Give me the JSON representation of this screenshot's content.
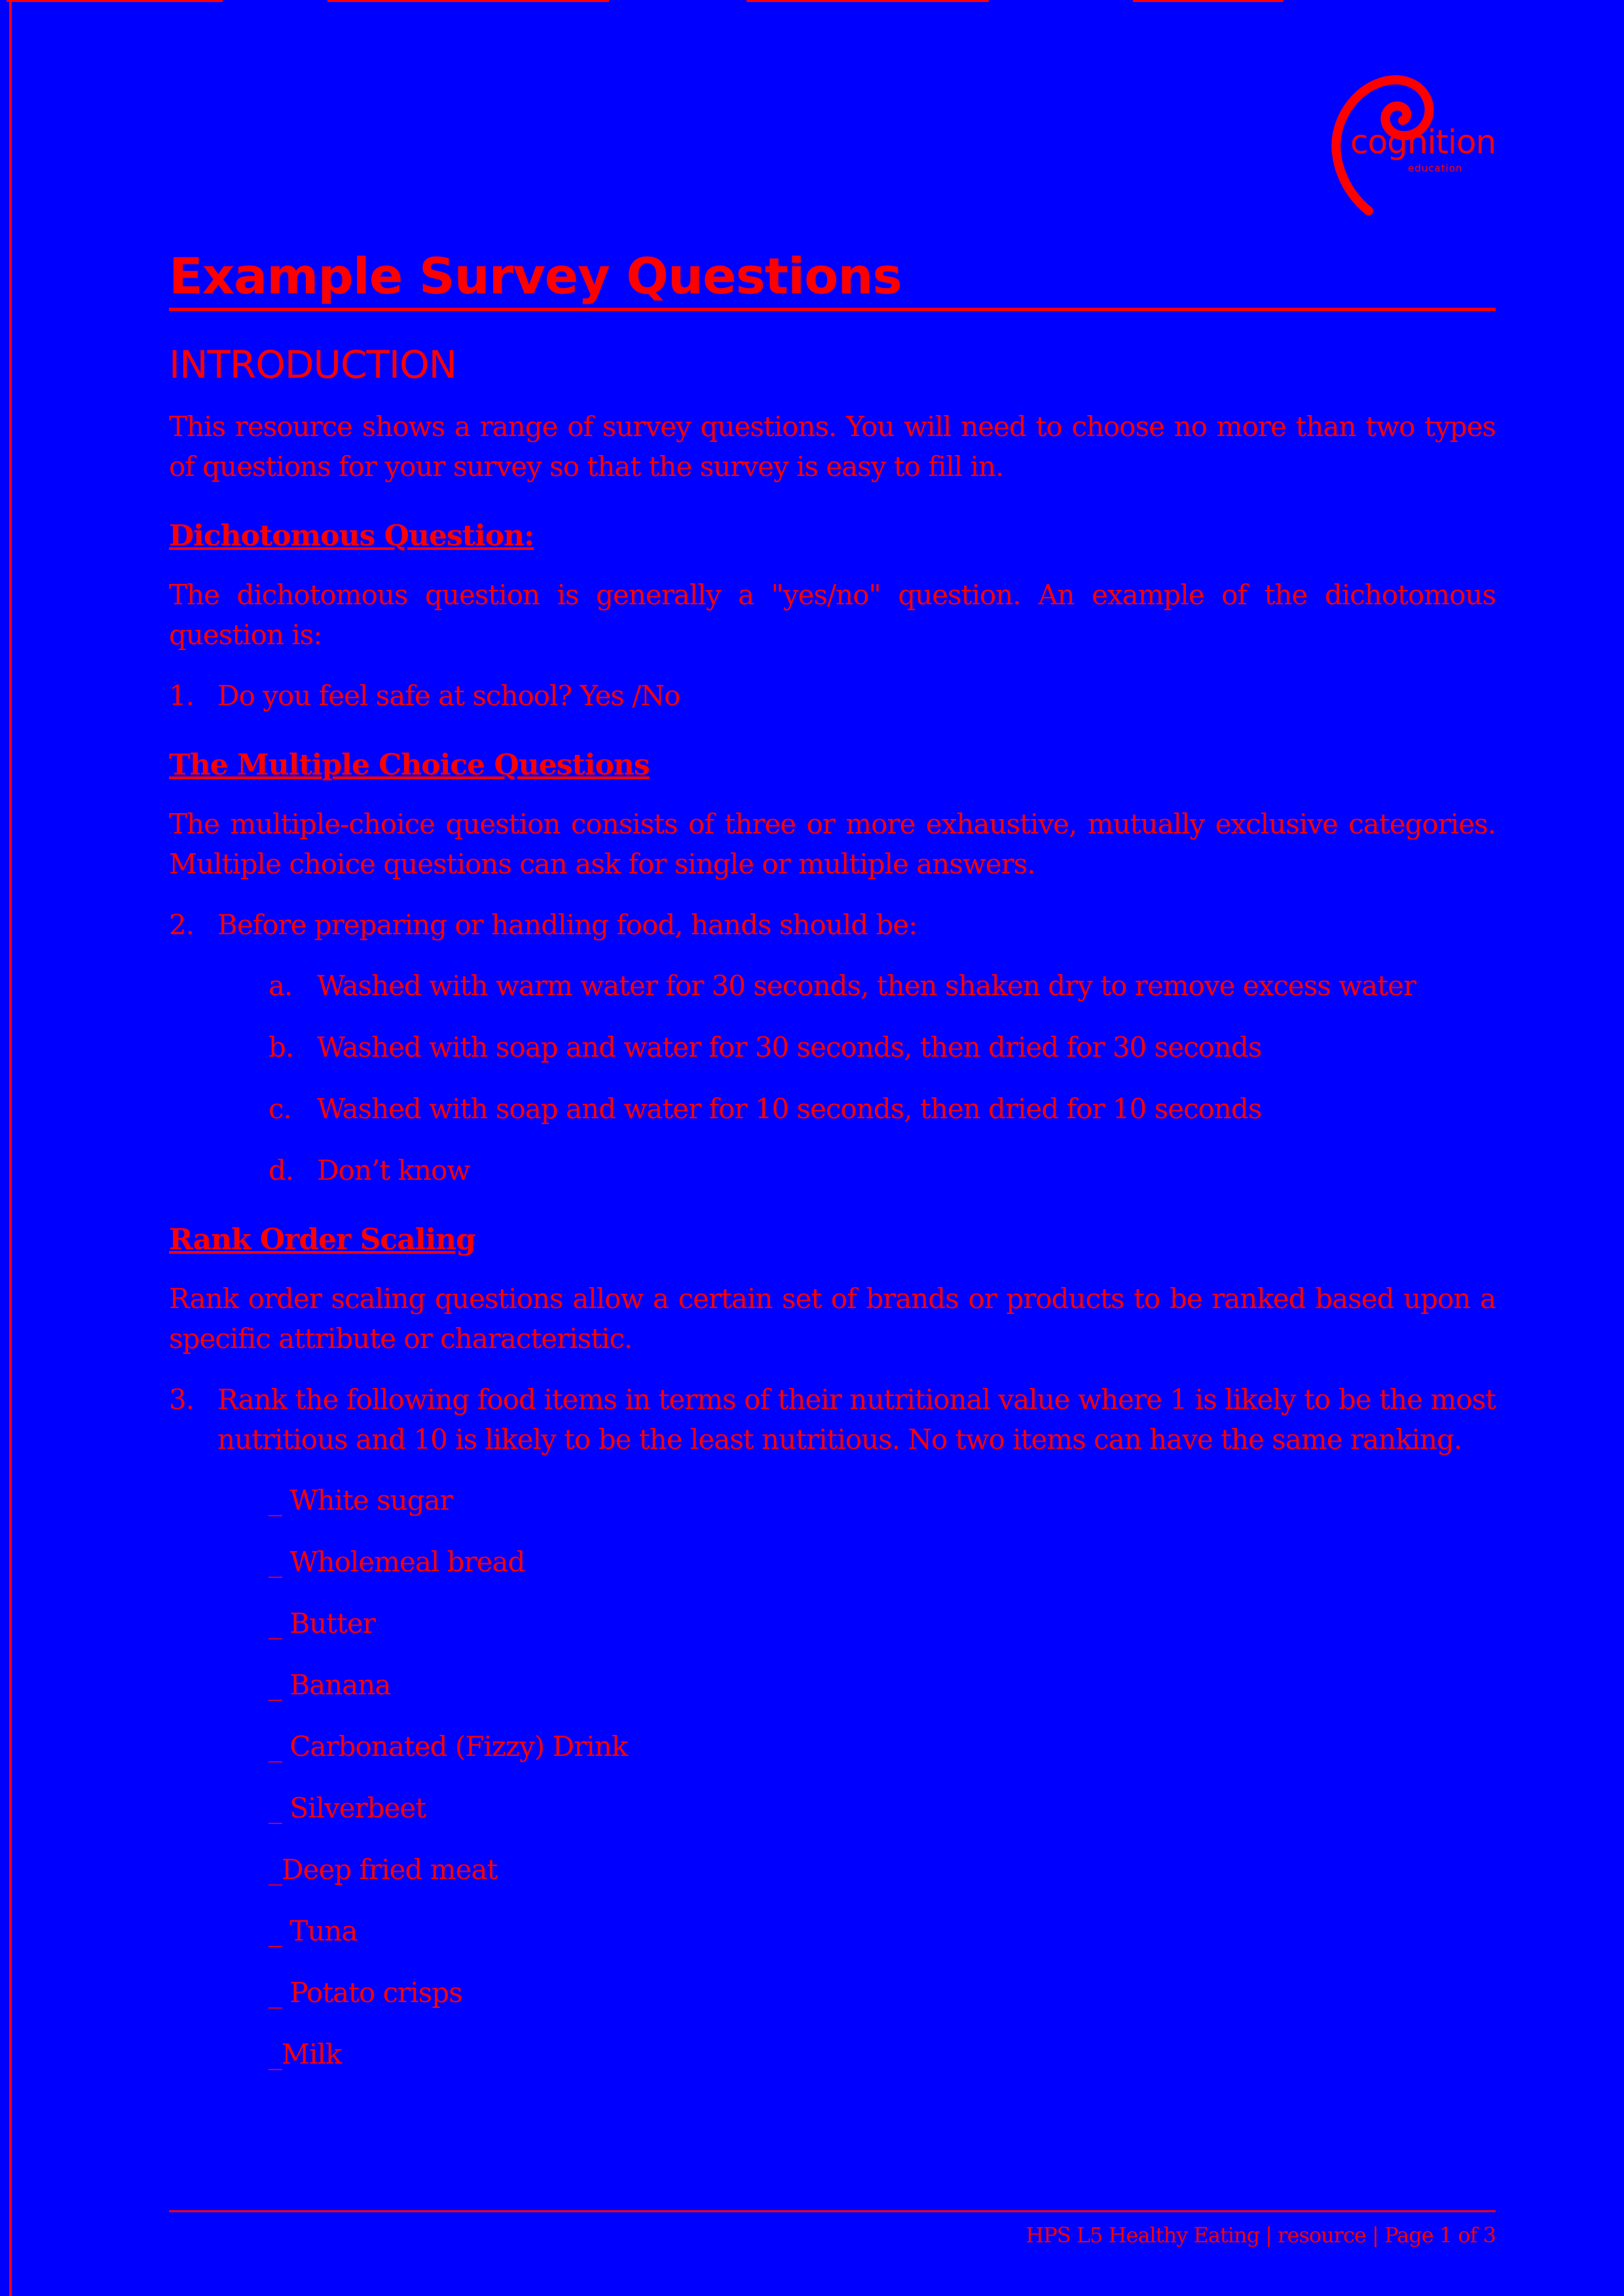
{
  "logo": {
    "word": "cognition",
    "sub": "education"
  },
  "title": "Example Survey Questions",
  "intro": {
    "heading": "INTRODUCTION",
    "text": "This resource shows a range of survey questions. You will need to choose no more than two types of questions for your survey so that the survey is easy to fill in."
  },
  "dichotomous": {
    "heading": "Dichotomous Question:",
    "text": "The dichotomous question is generally a \"yes/no\" question. An example of the dichotomous question is:",
    "q_num": "1.",
    "q_text": "Do you feel safe at school?  Yes /No"
  },
  "multiple": {
    "heading": "The Multiple Choice Questions",
    "text": "The multiple-choice question consists of three or more exhaustive, mutually exclusive categories.  Multiple choice questions can ask for single or multiple answers.",
    "q_num": "2.",
    "q_text": "Before preparing or handling food, hands should be:",
    "options": [
      {
        "letter": "a.",
        "text": "Washed with warm water for 30 seconds, then shaken dry to remove excess water"
      },
      {
        "letter": "b.",
        "text": "Washed with soap and water for 30 seconds, then dried for 30 seconds"
      },
      {
        "letter": "c.",
        "text": "Washed with soap and water for 10 seconds, then dried for 10 seconds"
      },
      {
        "letter": "d.",
        "text": "Don’t know"
      }
    ]
  },
  "rank": {
    "heading": "Rank Order Scaling",
    "text": "Rank order scaling questions allow a certain set of brands or products to be ranked based upon a specific attribute or characteristic.",
    "q_num": "3.",
    "q_text": "Rank the following food items in terms of their nutritional value where 1 is likely to be the most nutritious and 10 is likely to be the least nutritious. No two items can have the same ranking.",
    "items": [
      "_ White sugar",
      "_ Wholemeal bread",
      "_ Butter",
      "_ Banana",
      "_ Carbonated (Fizzy) Drink",
      "_ Silverbeet",
      "_Deep fried meat",
      "_ Tuna",
      "_ Potato crisps",
      "_Milk"
    ]
  },
  "footer": "HPS L5 Healthy Eating | resource | Page 1 of 3",
  "colors": {
    "background": "#0000ff",
    "text": "#ff0000"
  }
}
